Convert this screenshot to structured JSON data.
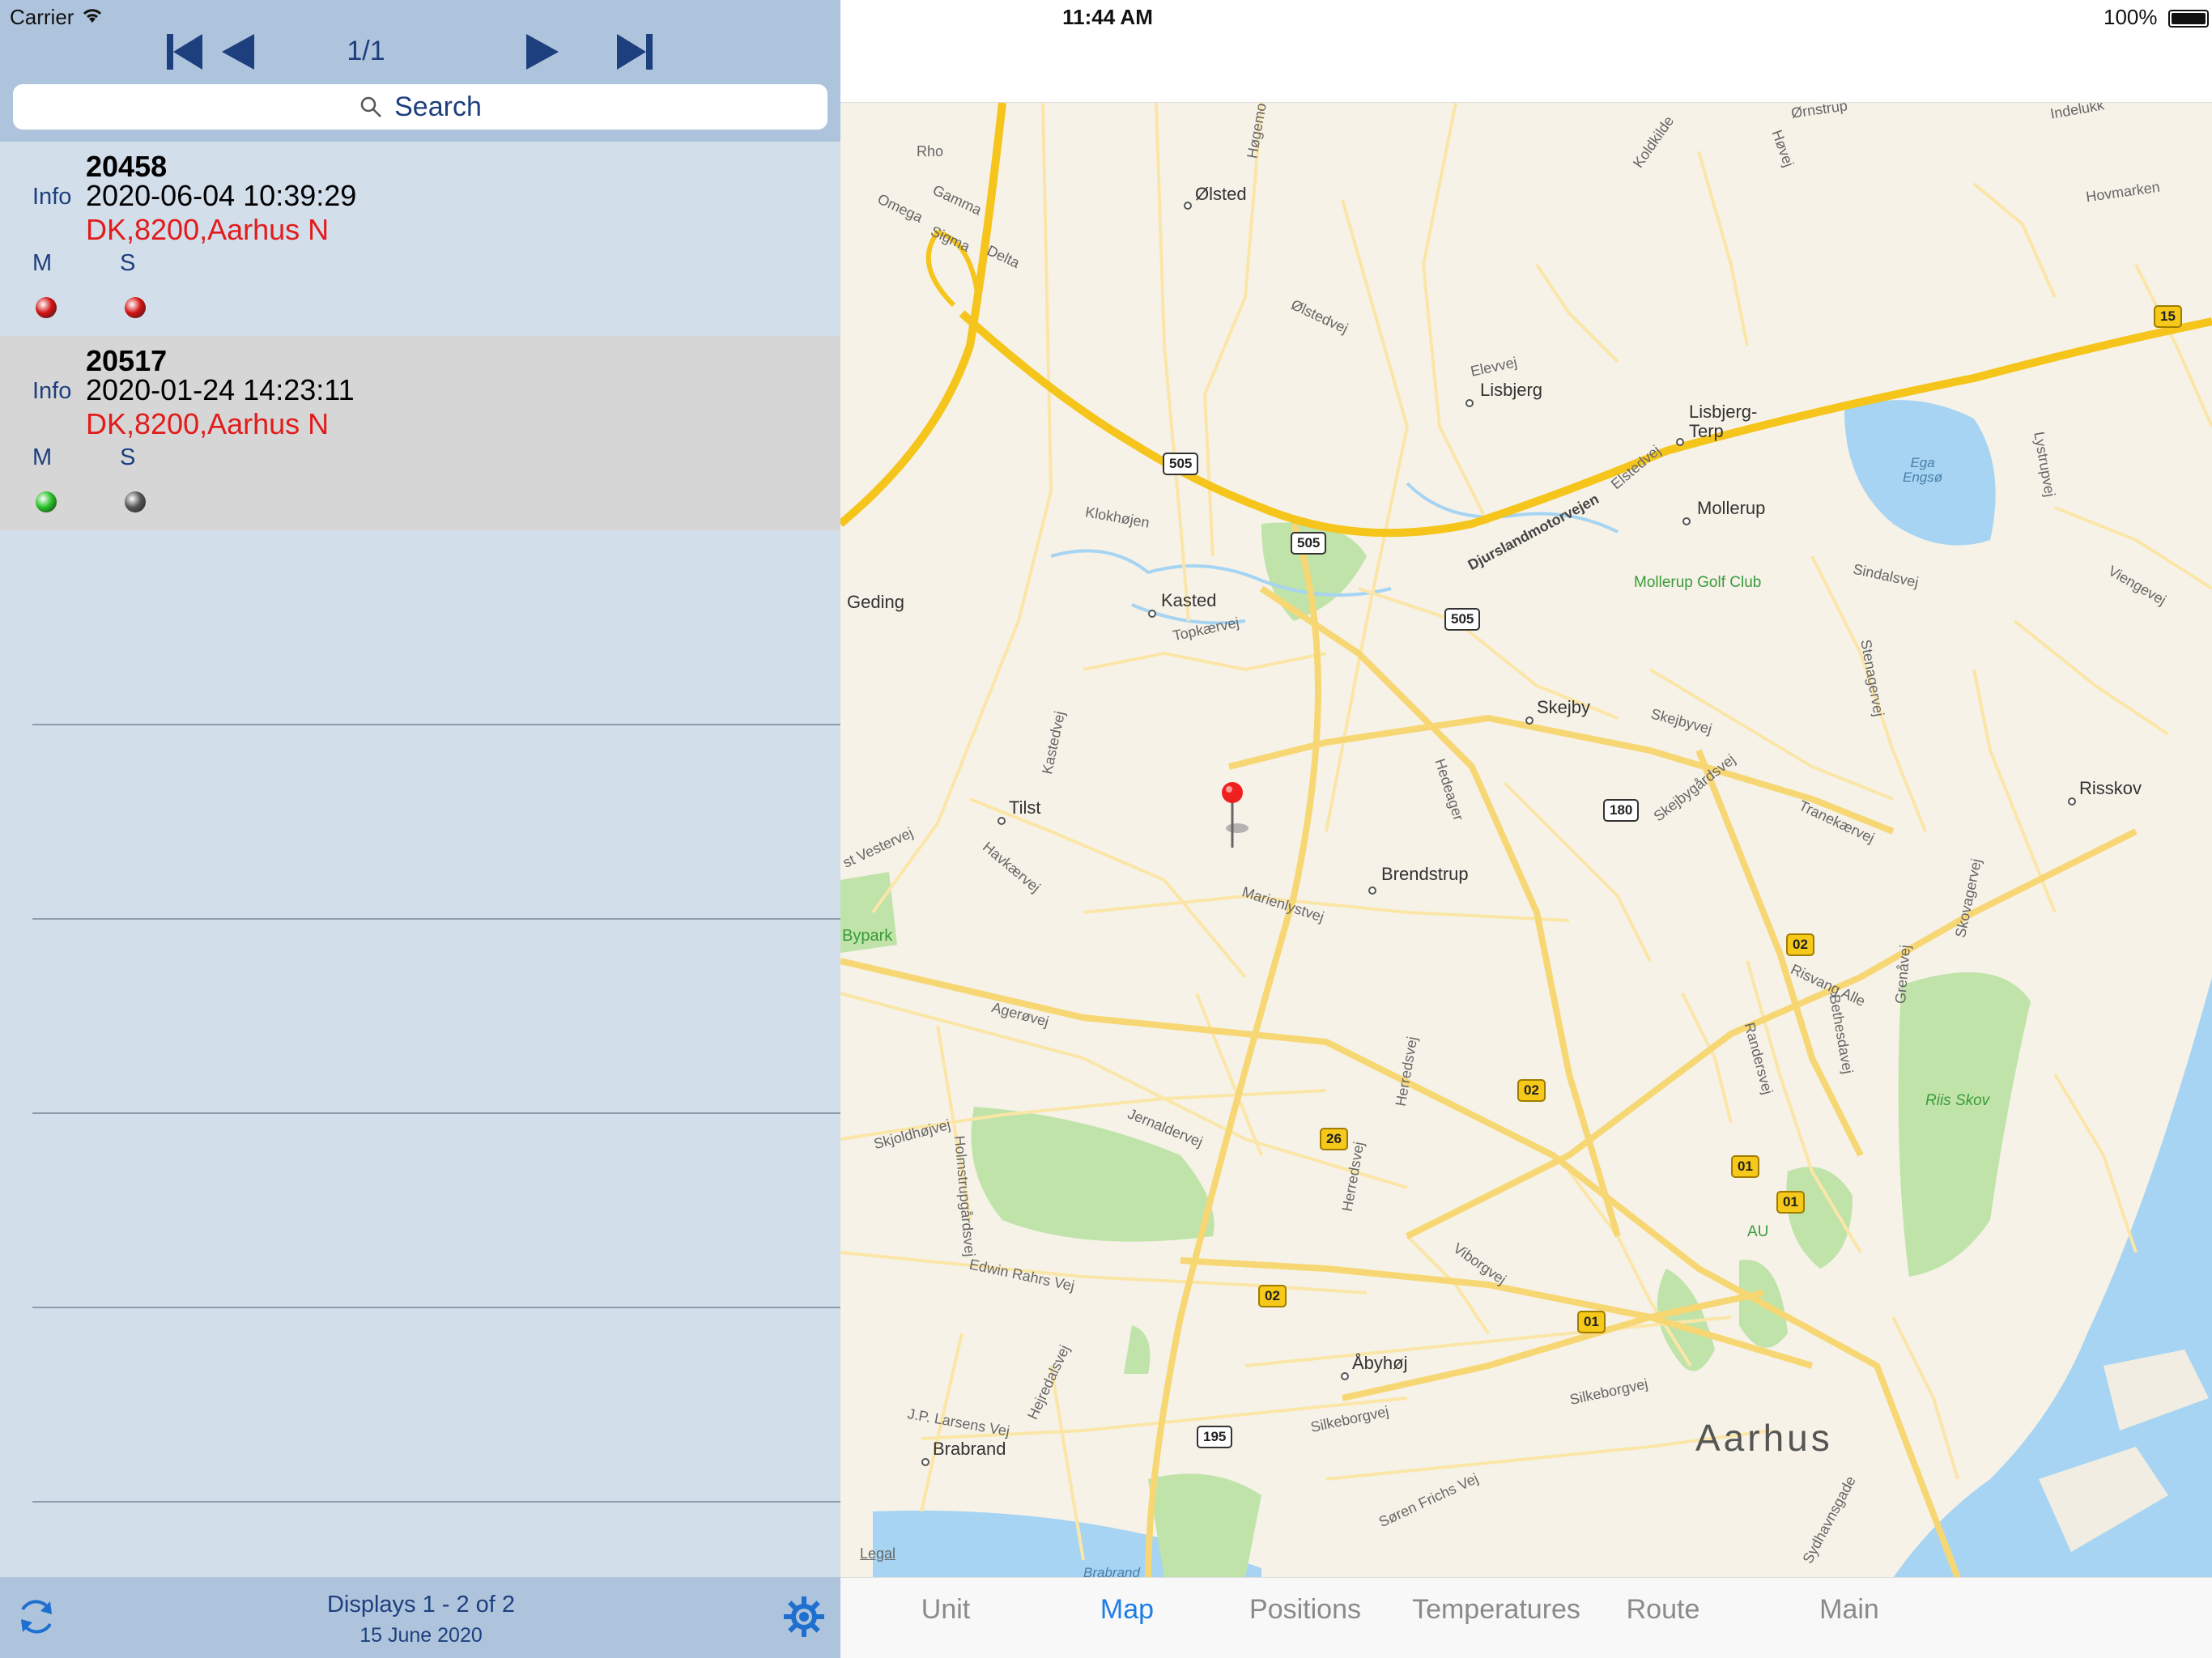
{
  "left_status": {
    "carrier": "Carrier"
  },
  "pager": {
    "page": "1/1"
  },
  "search": {
    "placeholder": "Search"
  },
  "records": [
    {
      "id": "20458",
      "info_label": "Info",
      "timestamp": "2020-06-04 10:39:29",
      "location": "DK,8200,Aarhus N",
      "m_label": "M",
      "s_label": "S",
      "m_color": "#d31212",
      "s_color": "#d31212"
    },
    {
      "id": "20517",
      "info_label": "Info",
      "timestamp": "2020-01-24 14:23:11",
      "location": "DK,8200,Aarhus N",
      "m_label": "M",
      "s_label": "S",
      "m_color": "#27c227",
      "s_color": "#555555"
    }
  ],
  "footer": {
    "count": "Displays 1 - 2 of 2",
    "date": "15 June 2020"
  },
  "right_status": {
    "time": "11:44 AM",
    "battery": "100%"
  },
  "map": {
    "places": {
      "olsted": "Ølsted",
      "lisbjerg": "Lisbjerg",
      "lisbjerg_terp": "Lisbjerg-\nTerp",
      "mollerup": "Mollerup",
      "mollerup_golf": "Mollerup Golf Club",
      "geding": "Geding",
      "kasted": "Kasted",
      "skejby": "Skejby",
      "tilst": "Tilst",
      "brendstrup": "Brendstrup",
      "risskov": "Risskov",
      "bypark": "Bypark",
      "abyhoj": "Åbyhøj",
      "brabrand": "Brabrand",
      "aarhus": "Aarhus",
      "riis_skov": "Riis Skov",
      "au": "AU",
      "ega_engso": "Ega\nEngsø",
      "brabrand_lake": "Brabrand",
      "legal": "Legal",
      "rho": "Rho"
    },
    "streets": {
      "djurs": "Djurslandmotorvejen",
      "klokhojen": "Klokhøjen",
      "olstedvej": "Ølstedvej",
      "elevvej": "Elevvej",
      "elstedvej": "Elstedvej",
      "sindalsvej": "Sindalsvej",
      "viengevej": "Viengevej",
      "topkaervej": "Topkærvej",
      "kastedvej": "Kastedvej",
      "havkaervej": "Havkærvej",
      "vestervej": "st Vestervej",
      "marienlystvej": "Marienlystvej",
      "skejbyvej": "Skejbyvej",
      "skejbygardsvej": "Skejbygårdsvej",
      "hedeager": "Hedeager",
      "stenagervej": "Stenagervej",
      "tranekaervej": "Tranekærvej",
      "skovagervej": "Skovagervej",
      "risvang": "Risvang Alle",
      "grenavej": "Grenåvej",
      "bethesdavej": "Bethesdavej",
      "randersvej": "Randersvej",
      "agerovej": "Agerøvej",
      "jernaldervej": "Jernaldervej",
      "herredsvej": "Herredsvej",
      "skjoldhojvej": "Skjoldhøjvej",
      "holmstrup": "Holmstrupgårdsvej",
      "edwin": "Edwin Rahrs Vej",
      "viborgvej": "Viborgvej",
      "hejredalsvej": "Hejredalsvej",
      "jplarsens": "J.P. Larsens Vej",
      "silkeborgvej": "Silkeborgvej",
      "soren": "Søren Frichs Vej",
      "sydhavnsgade": "Sydhavnsgade",
      "koldkilde": "Koldkilde",
      "hovej": "Høvej",
      "ornstrup": "Ørnstrup",
      "indelukket": "Indelukk",
      "hovmarken": "Hovmarken",
      "lystrupvej": "Lystrupvej",
      "gamma": "Gamma",
      "omega": "Omega",
      "sigma": "Sigma",
      "delta": "Delta",
      "hogemos": "Høgemo"
    },
    "shields": {
      "r505": "505",
      "r180": "180",
      "r195": "195",
      "r15": "15",
      "r02": "02",
      "r26": "26",
      "r01": "01"
    }
  },
  "tabs": [
    {
      "label": "Unit"
    },
    {
      "label": "Map"
    },
    {
      "label": "Positions"
    },
    {
      "label": "Temperatures"
    },
    {
      "label": "Route"
    },
    {
      "label": "Main"
    }
  ]
}
